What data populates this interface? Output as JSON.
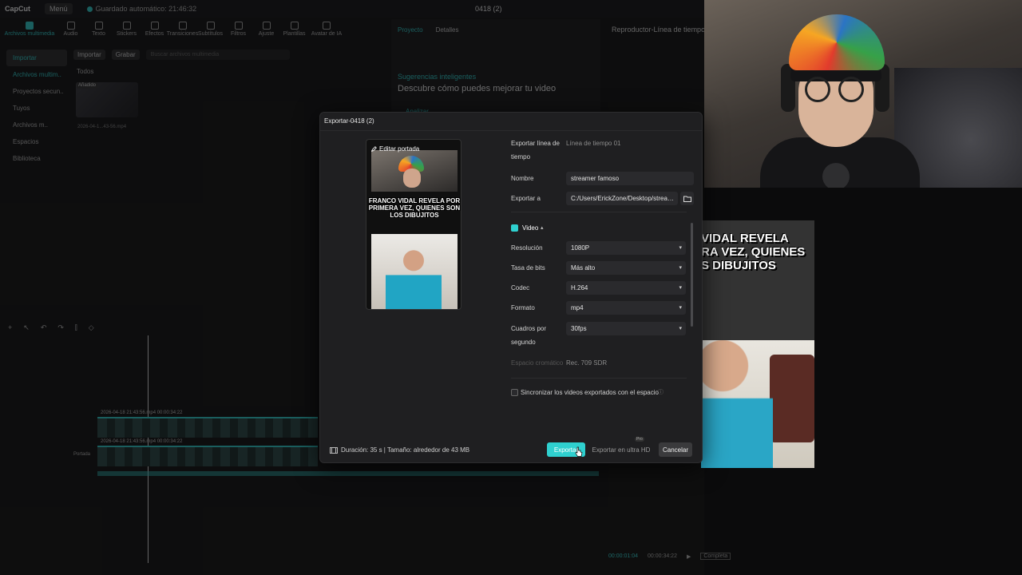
{
  "app": {
    "logo": "CapCut",
    "menu_label": "Menú",
    "autosave": "Guardado automático: 21:46:32",
    "project_title": "0418 (2)",
    "toolbar": [
      "Archivos multimedia",
      "Audio",
      "Texto",
      "Stickers",
      "Efectos",
      "Transiciones",
      "Subtítulos",
      "Filtros",
      "Ajuste",
      "Plantillas",
      "Avatar de IA"
    ],
    "sidebar": [
      "Importar",
      "Archivos multim..",
      "Proyectos secun..",
      "Tuyos",
      "Archivos m..",
      "Espacios",
      "Biblioteca"
    ],
    "media": {
      "import_label": "Importar",
      "record_label": "Grabar",
      "search_placeholder": "Buscar archivos multimedia",
      "filter_label": "Todos",
      "thumb_badge": "Añadido",
      "thumb_name": "2026-04-1...43-56.mp4"
    },
    "right_panel": {
      "tab_project": "Proyecto",
      "tab_details": "Detalles",
      "suggestions_title": "Sugerencias inteligentes",
      "suggestions_desc": "Descubre cómo puedes mejorar tu video",
      "analyze_label": "Analizar"
    },
    "player_title": "Reproductor-Línea de tiempo 01",
    "timeline": {
      "clip1_label": "2026-04-18 21:43:56.mp4   00:00:34:22",
      "clip2_label": "2026-04-18 21:43:56.mp4   00:00:34:22",
      "cover_label": "Portada",
      "time_current": "00:00:01:04",
      "time_total": "00:00:34:22",
      "full_label": "Completa"
    }
  },
  "dialog": {
    "title": "Exportar-0418 (2)",
    "edit_cover": "Editar portada",
    "cover_caption": "FRANCO VIDAL REVELA POR PRIMERA VEZ, QUIENES SON LOS DIBUJITOS",
    "export_timeline_label": "Exportar línea de tiempo",
    "export_timeline_value": "Línea de tiempo 01",
    "name_label": "Nombre",
    "name_value": "streamer famoso",
    "export_to_label": "Exportar a",
    "export_to_value": "C:/Users/ErickZone/Desktop/stream...",
    "video_label": "Video",
    "resolution_label": "Resolución",
    "resolution_value": "1080P",
    "bitrate_label": "Tasa de bits",
    "bitrate_value": "Más alto",
    "codec_label": "Codec",
    "codec_value": "H.264",
    "format_label": "Formato",
    "format_value": "mp4",
    "fps_label": "Cuadros por segundo",
    "fps_value": "30fps",
    "colorspace_label": "Espacio cromático",
    "colorspace_value": "Rec. 709 SDR",
    "sync_label": "Sincronizar los videos exportados con el espacio",
    "duration_info": "Duración: 35 s | Tamaño: alrededor de 43 MB",
    "export_button": "Exportar",
    "export_uhd_button": "Exportar en ultra HD",
    "pro_badge": "Pro",
    "cancel_button": "Cancelar"
  },
  "overlay_preview_text": "VIDAL REVELA\nRA VEZ, QUIENES\nS DIBUJITOS",
  "colors": {
    "accent": "#2fd0cf",
    "dialog_bg": "#1f1f21"
  }
}
